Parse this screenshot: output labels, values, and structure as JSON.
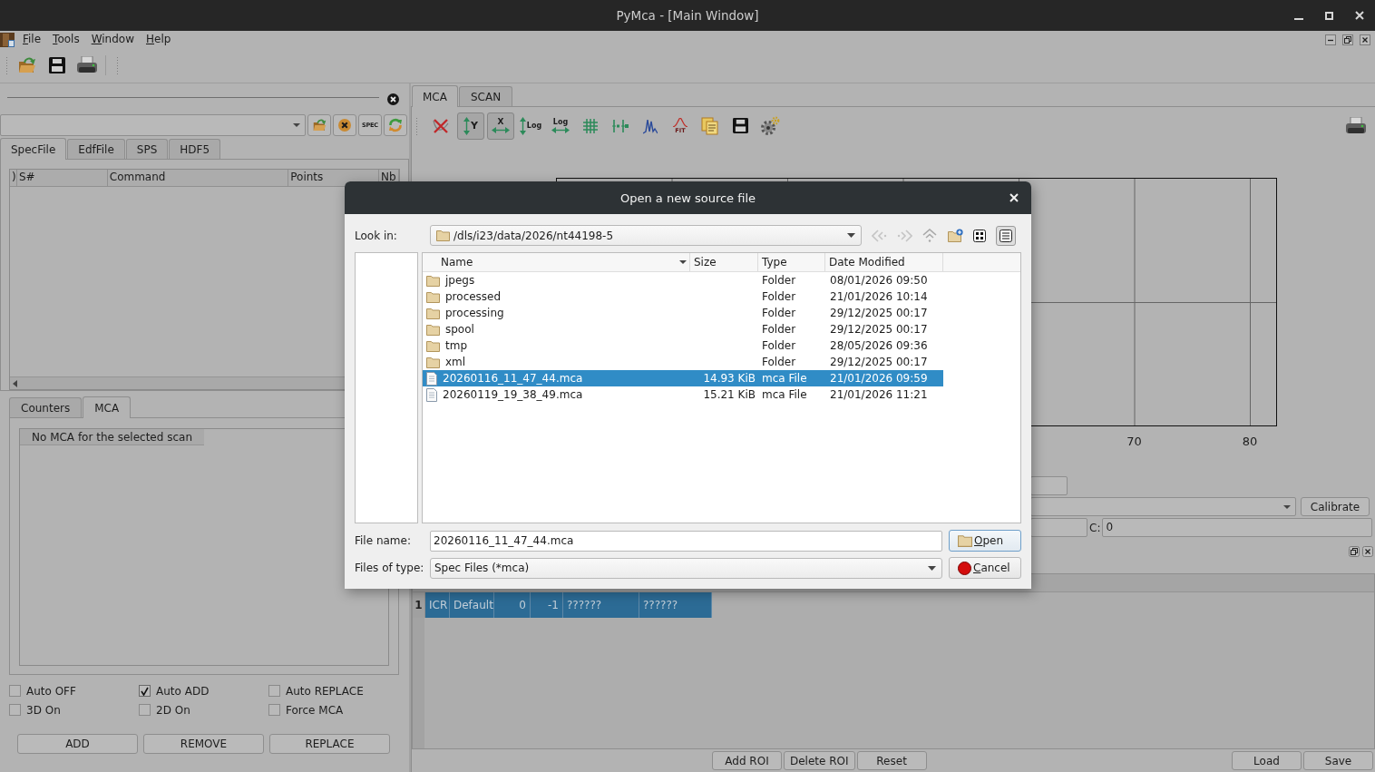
{
  "window": {
    "title": "PyMca - [Main Window]"
  },
  "menu": [
    {
      "label": "File"
    },
    {
      "label": "Tools"
    },
    {
      "label": "Window"
    },
    {
      "label": "Help"
    }
  ],
  "source_panel": {
    "spec_button": "SPEC",
    "tabs": [
      {
        "label": "SpecFile",
        "selected": true
      },
      {
        "label": "EdfFile",
        "selected": false
      },
      {
        "label": "SPS",
        "selected": false
      },
      {
        "label": "HDF5",
        "selected": false
      }
    ],
    "table_columns": [
      ")",
      "S#",
      "Command",
      "Points",
      "Nb"
    ],
    "data_tabs": [
      {
        "label": "Counters",
        "selected": false
      },
      {
        "label": "MCA",
        "selected": true
      }
    ],
    "mca_list_header": "No MCA for the selected scan",
    "options": [
      {
        "label": "Auto OFF",
        "checked": false
      },
      {
        "label": "Auto ADD",
        "checked": true
      },
      {
        "label": "Auto REPLACE",
        "checked": false
      },
      {
        "label": "3D On",
        "checked": false
      },
      {
        "label": "2D On",
        "checked": false
      },
      {
        "label": "Force MCA",
        "checked": false
      }
    ],
    "buttons": [
      "ADD",
      "REMOVE",
      "REPLACE"
    ]
  },
  "plot_panel": {
    "tabs": [
      {
        "label": "MCA",
        "selected": true
      },
      {
        "label": "SCAN",
        "selected": false
      }
    ],
    "toolbar": [
      {
        "kind": "clear",
        "pressed": false
      },
      {
        "kind": "y-autoscale",
        "label": "Y",
        "pressed": true
      },
      {
        "kind": "x-autoscale",
        "label": "X",
        "pressed": true
      },
      {
        "kind": "y-log",
        "label": "Log",
        "pressed": false
      },
      {
        "kind": "x-log",
        "label": "Log",
        "pressed": false
      },
      {
        "kind": "grid",
        "pressed": false
      },
      {
        "kind": "roi",
        "pressed": false
      },
      {
        "kind": "peaks",
        "pressed": false
      },
      {
        "kind": "fit",
        "label": "FIT",
        "pressed": false
      },
      {
        "kind": "report",
        "pressed": false
      },
      {
        "kind": "save",
        "pressed": false
      },
      {
        "kind": "settings",
        "pressed": false
      }
    ],
    "x_tick_labels": [
      "70",
      "80"
    ],
    "calibrate_button": "Calibrate",
    "c_label": "C:",
    "c_value": "0",
    "roi_table": {
      "rows": [
        {
          "header": "1",
          "cells": [
            "ICR",
            "Default",
            "0",
            "-1",
            "??????",
            "??????"
          ],
          "selected": true
        }
      ]
    },
    "buttons": [
      "Add ROI",
      "Delete ROI",
      "Reset",
      "Load",
      "Save"
    ]
  },
  "dialog": {
    "title": "Open a new source file",
    "look_in": {
      "label": "Look in:",
      "value": "/dls/i23/data/2026/nt44198-5"
    },
    "nav_buttons": [
      {
        "kind": "back",
        "disabled": true
      },
      {
        "kind": "forward",
        "disabled": true
      },
      {
        "kind": "up",
        "disabled": false
      },
      {
        "kind": "new-folder",
        "disabled": false
      }
    ],
    "view_buttons": [
      {
        "kind": "icons",
        "selected": false
      },
      {
        "kind": "details",
        "selected": true
      }
    ],
    "columns": [
      "Name",
      "Size",
      "Type",
      "Date Modified"
    ],
    "files": [
      {
        "kind": "folder",
        "name": "jpegs",
        "type": "Folder",
        "modified": "08/01/2026 09:50",
        "selected": false
      },
      {
        "kind": "folder",
        "name": "processed",
        "type": "Folder",
        "modified": "21/01/2026 10:14",
        "selected": false
      },
      {
        "kind": "folder",
        "name": "processing",
        "type": "Folder",
        "modified": "29/12/2025 00:17",
        "selected": false
      },
      {
        "kind": "folder",
        "name": "spool",
        "type": "Folder",
        "modified": "29/12/2025 00:17",
        "selected": false
      },
      {
        "kind": "folder",
        "name": "tmp",
        "type": "Folder",
        "modified": "28/05/2026 09:36",
        "selected": false
      },
      {
        "kind": "folder",
        "name": "xml",
        "type": "Folder",
        "modified": "29/12/2025 00:17",
        "selected": false
      },
      {
        "kind": "file",
        "name": "20260116_11_47_44.mca",
        "size": "14.93 KiB",
        "type": "mca File",
        "modified": "21/01/2026 09:59",
        "selected": true
      },
      {
        "kind": "file",
        "name": "20260119_19_38_49.mca",
        "size": "15.21 KiB",
        "type": "mca File",
        "modified": "21/01/2026 11:21",
        "selected": false
      }
    ],
    "file_name": {
      "label": "File name:",
      "value": "20260116_11_47_44.mca"
    },
    "file_type": {
      "label": "Files of type:",
      "value": "Spec Files (*mca)"
    },
    "buttons": [
      {
        "kind": "open",
        "label": "Open",
        "default": true
      },
      {
        "kind": "cancel",
        "label": "Cancel",
        "default": false
      }
    ]
  }
}
